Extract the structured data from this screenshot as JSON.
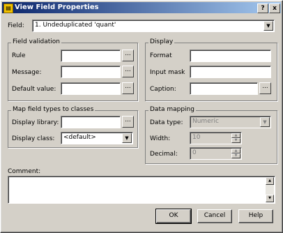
{
  "window": {
    "title": "View Field Properties",
    "help_btn": "?",
    "close_btn": "x"
  },
  "field": {
    "label": "Field:",
    "value": "1. Undeduplicated 'quant'"
  },
  "validation": {
    "title": "Field validation",
    "rule_label": "Rule",
    "message_label": "Message:",
    "default_label": "Default value:",
    "rule": "",
    "message": "",
    "default": ""
  },
  "display": {
    "title": "Display",
    "format_label": "Format",
    "input_mask_label": "Input mask",
    "caption_label": "Caption:",
    "format": "",
    "input_mask": "",
    "caption": ""
  },
  "map": {
    "title": "Map field types to classes",
    "library_label": "Display library:",
    "class_label": "Display class:",
    "library": "",
    "class": "<default>"
  },
  "data_mapping": {
    "title": "Data mapping",
    "type_label": "Data type:",
    "width_label": "Width:",
    "decimal_label": "Decimal:",
    "type": "Numeric",
    "width": "10",
    "decimal": "0"
  },
  "comment": {
    "label": "Comment:",
    "value": ""
  },
  "buttons": {
    "ok": "OK",
    "cancel": "Cancel",
    "help": "Help"
  },
  "dots": "..."
}
